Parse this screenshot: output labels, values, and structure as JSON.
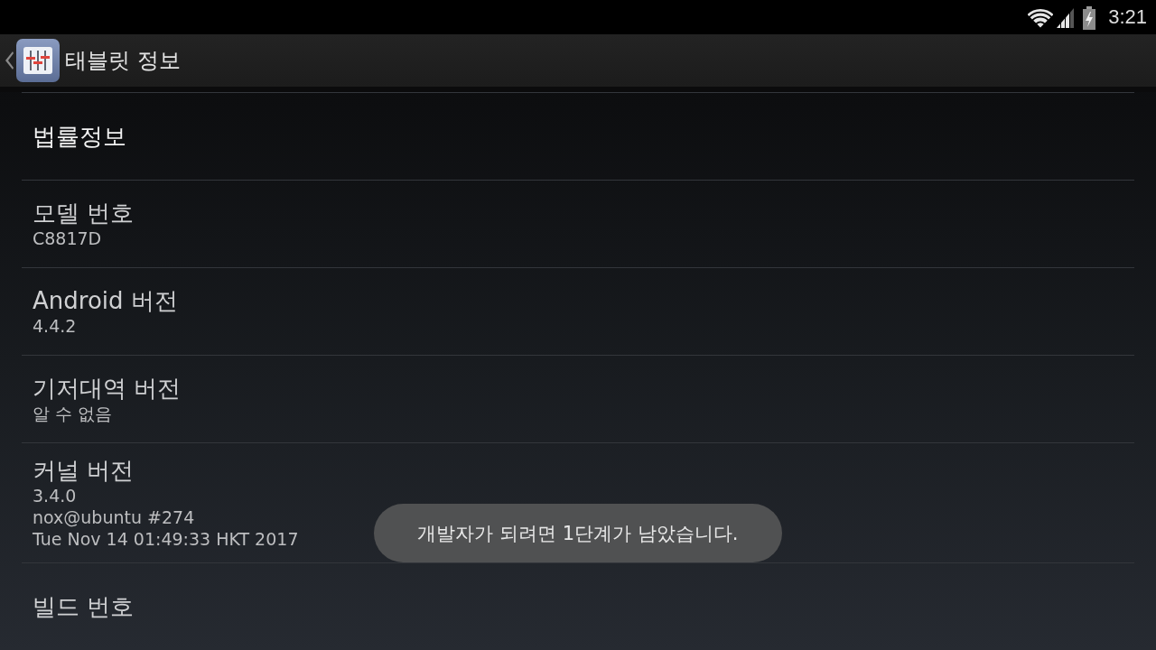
{
  "status_bar": {
    "time": "3:21"
  },
  "action_bar": {
    "title": "태블릿 정보"
  },
  "settings_list": [
    {
      "kind": "link",
      "title": "법률정보"
    },
    {
      "kind": "info",
      "title": "모델 번호",
      "summary": "C8817D"
    },
    {
      "kind": "info",
      "title": "Android 버전",
      "summary": "4.4.2"
    },
    {
      "kind": "info",
      "title": "기저대역 버전",
      "summary": "알 수 없음"
    },
    {
      "kind": "info",
      "title": "커널 버전",
      "summary": "3.4.0\nnox@ubuntu #274\nTue Nov 14 01:49:33 HKT 2017"
    },
    {
      "kind": "info",
      "title": "빌드 번호"
    }
  ],
  "toast": {
    "text": "개발자가 되려면 1단계가 남았습니다."
  }
}
